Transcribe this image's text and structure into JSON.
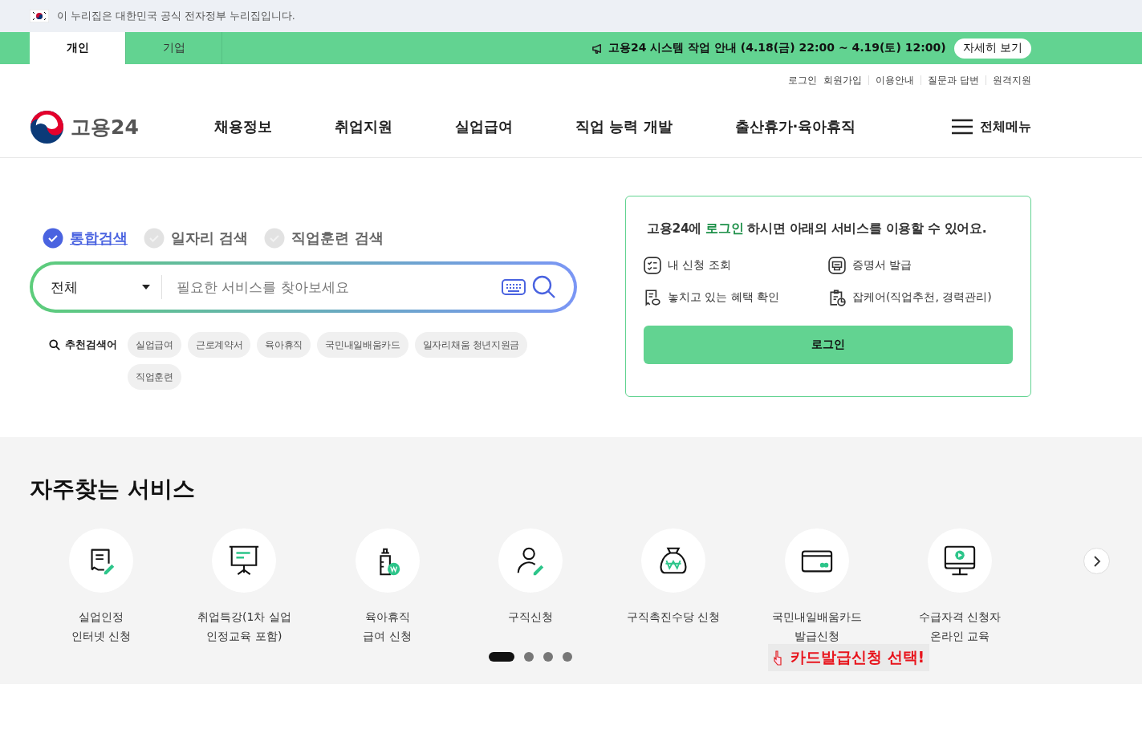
{
  "gov_banner": {
    "text": "이 누리집은 대한민국 공식 전자정부 누리집입니다."
  },
  "user_tabs": [
    {
      "label": "개인",
      "selected": true
    },
    {
      "label": "기업",
      "selected": false
    }
  ],
  "notice": {
    "text": "고용24 시스템 작업 안내 (4.18(금) 22:00 ~ 4.19(토) 12:00)",
    "button": "자세히 보기"
  },
  "utility_links": [
    "로그인",
    "회원가입",
    "이용안내",
    "질문과 답변",
    "원격지원"
  ],
  "logo": {
    "text": "고용24"
  },
  "nav": [
    "채용정보",
    "취업지원",
    "실업급여",
    "직업 능력 개발",
    "출산휴가·육아휴직"
  ],
  "all_menu": "전체메뉴",
  "search_tabs": [
    {
      "label": "통합검색",
      "selected": true
    },
    {
      "label": "일자리 검색",
      "selected": false
    },
    {
      "label": "직업훈련 검색",
      "selected": false
    }
  ],
  "search": {
    "category": "전체",
    "placeholder": "필요한 서비스를 찾아보세요"
  },
  "recommended": {
    "label": "추천검색어",
    "terms": [
      "실업급여",
      "근로계약서",
      "육아휴직",
      "국민내일배움카드",
      "일자리채움 청년지원금",
      "직업훈련"
    ]
  },
  "login_card": {
    "before": "고용24에 ",
    "link": "로그인",
    "after": " 하시면 아래의 서비스를 이용할 수 있어요.",
    "services": [
      "내 신청 조회",
      "증명서 발급",
      "놓치고 있는 혜택 확인",
      "잡케어(직업추천, 경력관리)"
    ],
    "button": "로그인"
  },
  "frequent": {
    "title": "자주찾는 서비스",
    "items": [
      [
        "실업인정",
        "인터넷 신청"
      ],
      [
        "취업특강(1차 실업",
        "인정교육 포함)"
      ],
      [
        "육아휴직",
        "급여 신청"
      ],
      [
        "구직신청"
      ],
      [
        "구직촉진수당 신청"
      ],
      [
        "국민내일배움카드",
        "발급신청"
      ],
      [
        "수급자격 신청자",
        "온라인 교육"
      ]
    ],
    "pages": [
      {
        "selected": true
      },
      {
        "selected": false
      },
      {
        "selected": false
      },
      {
        "selected": false
      }
    ],
    "callout": "카드발급신청 선택!"
  }
}
